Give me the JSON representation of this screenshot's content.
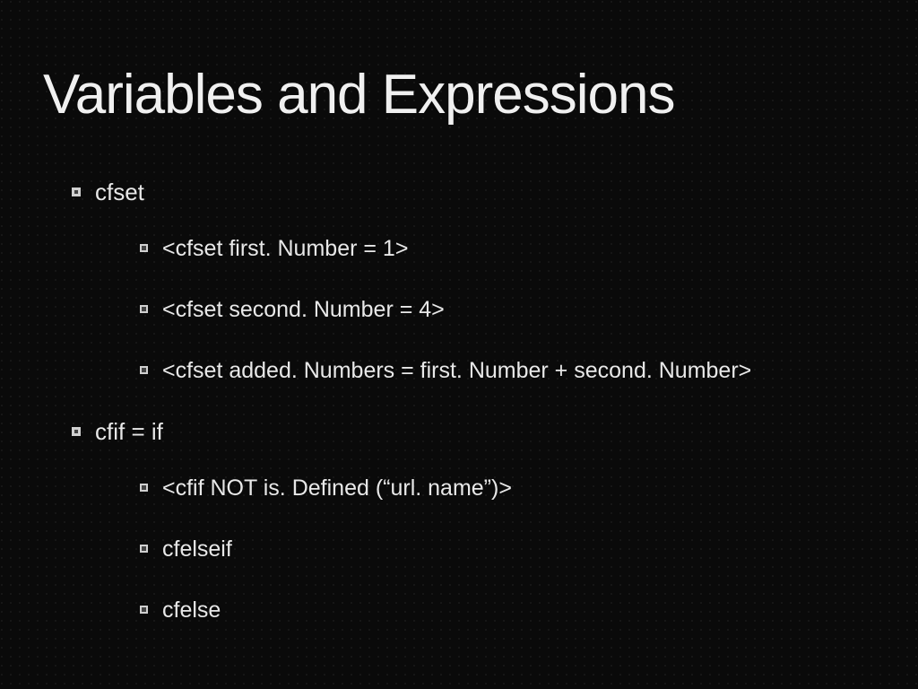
{
  "title": "Variables and Expressions",
  "items": [
    {
      "label": "cfset",
      "children": [
        {
          "label": "<cfset first. Number = 1>"
        },
        {
          "label": "<cfset second. Number = 4>"
        },
        {
          "label": "<cfset added. Numbers = first. Number + second. Number>"
        }
      ]
    },
    {
      "label": "cfif = if",
      "children": [
        {
          "label": "<cfif NOT is. Defined (“url. name”)>"
        },
        {
          "label": "cfelseif"
        },
        {
          "label": "cfelse"
        }
      ]
    }
  ]
}
